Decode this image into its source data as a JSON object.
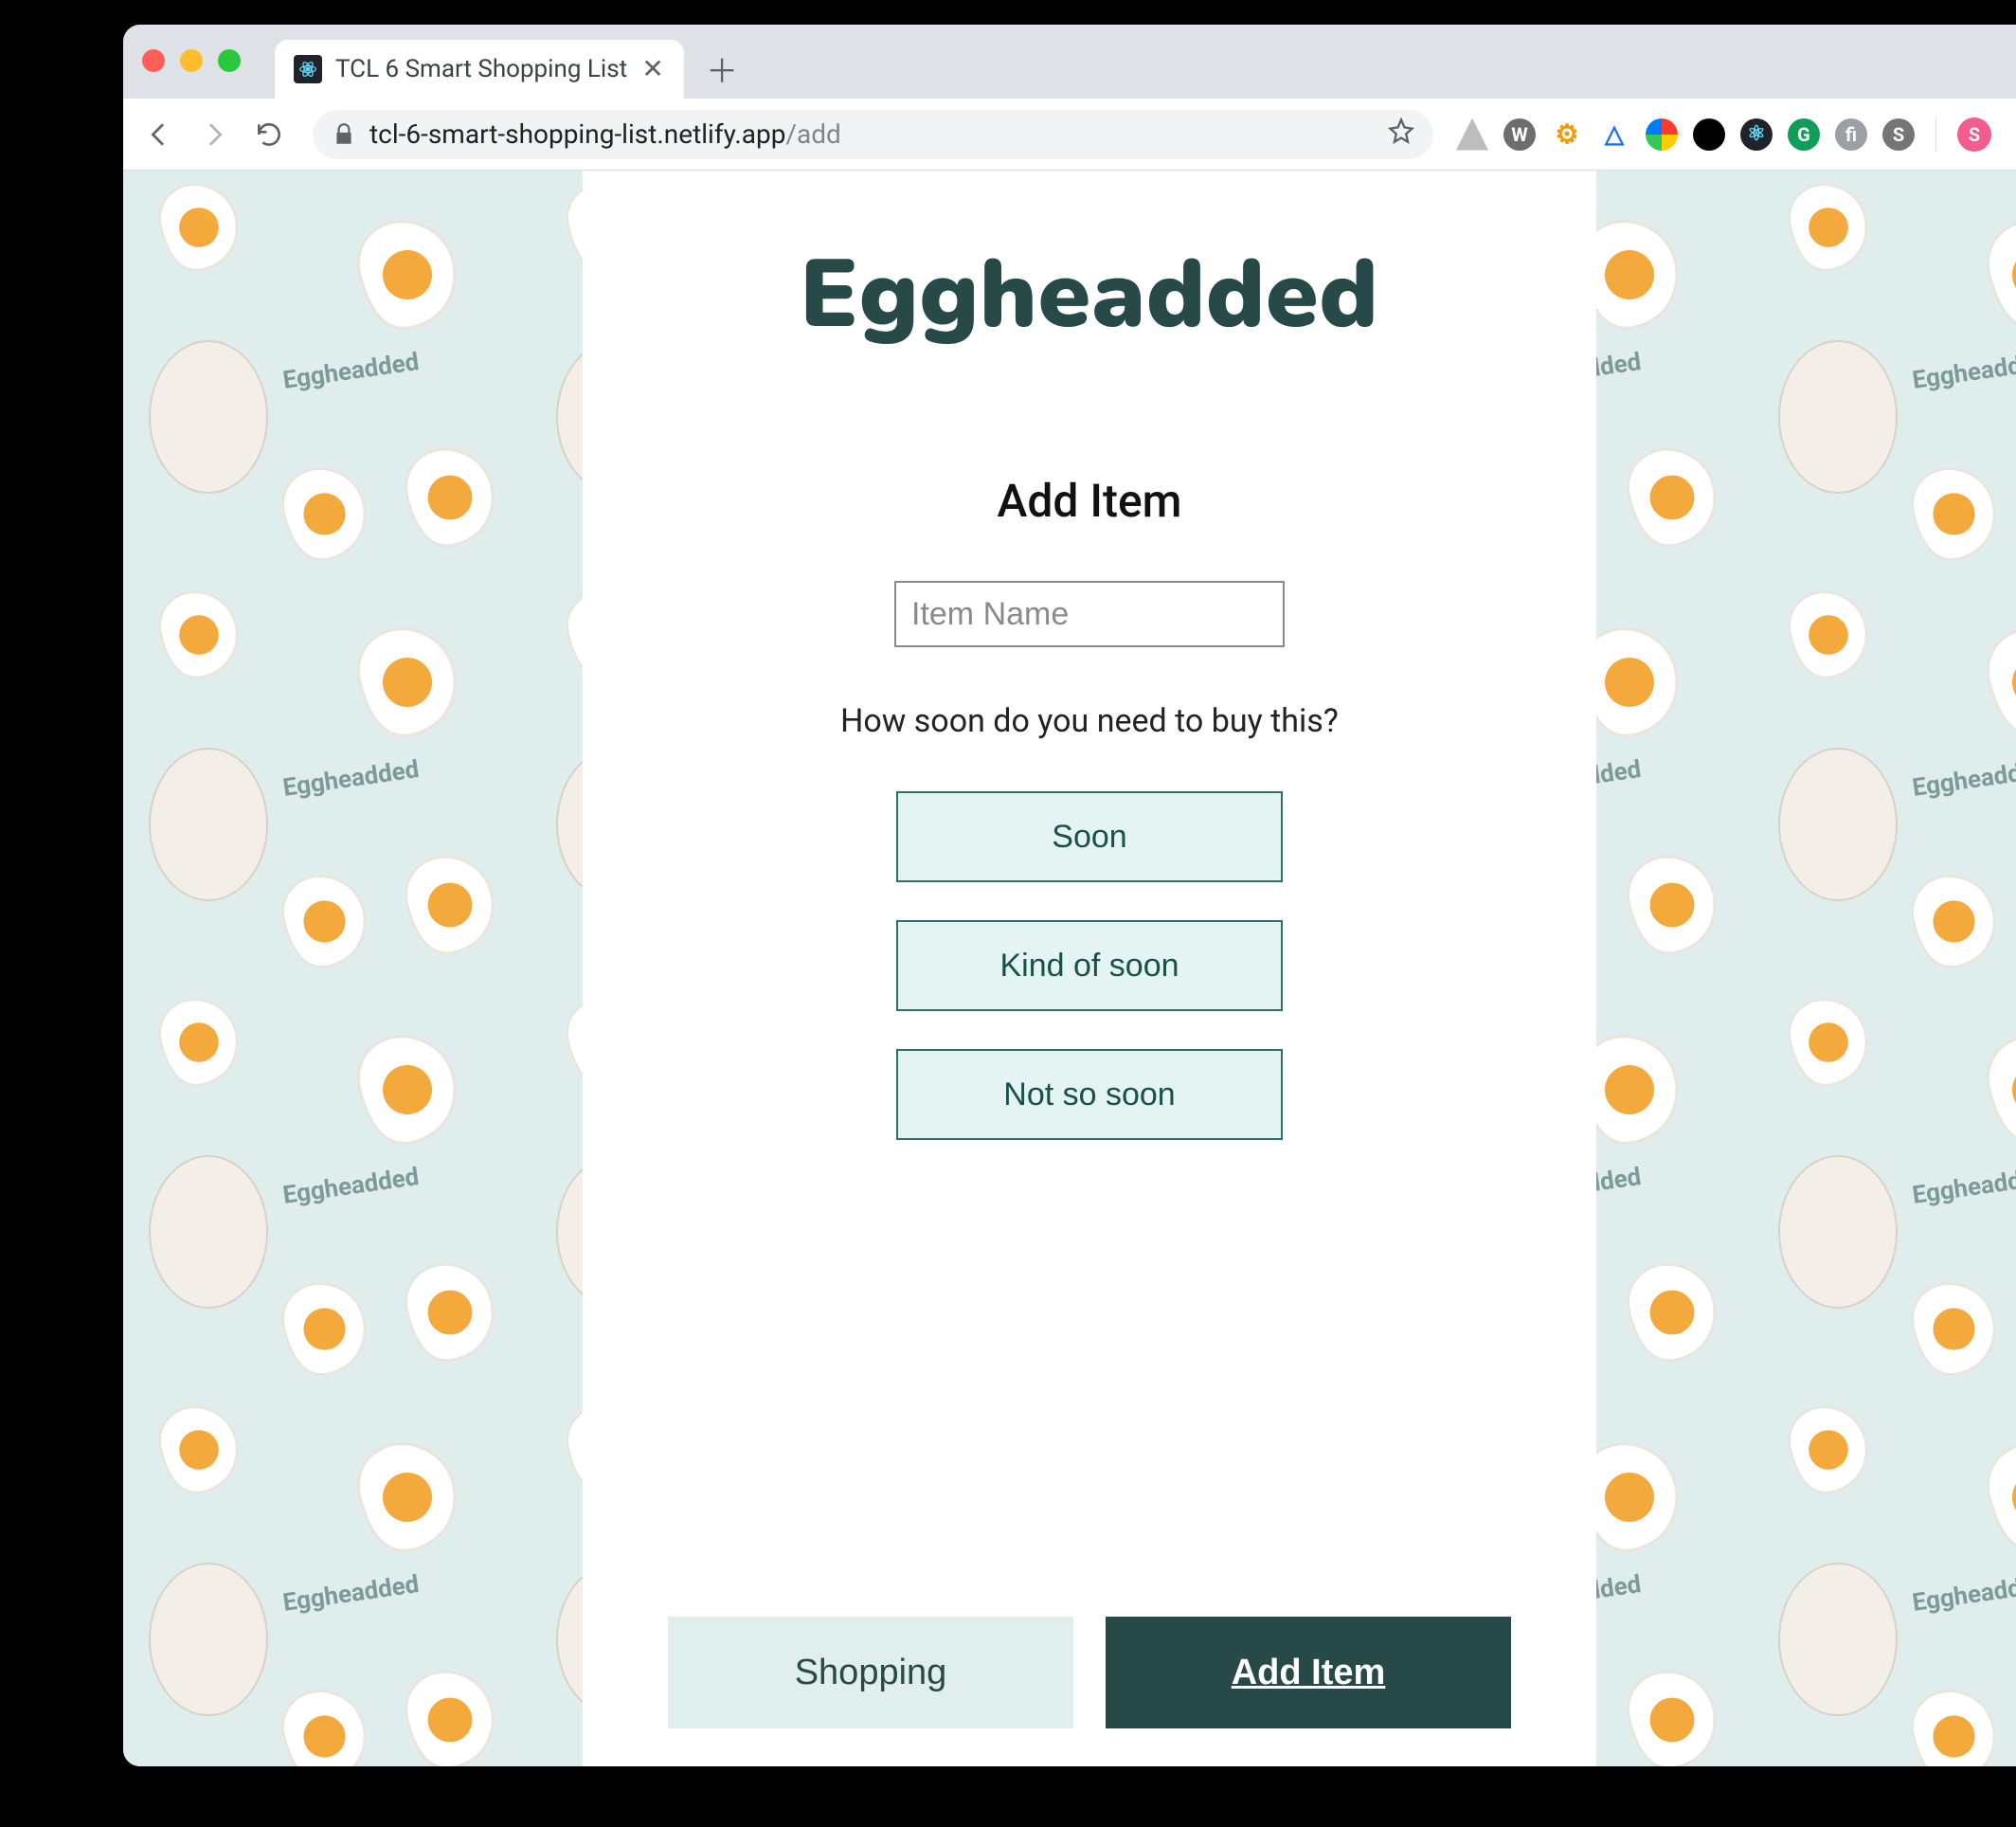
{
  "browser": {
    "tab_title": "TCL 6 Smart Shopping List",
    "url_host": "tcl-6-smart-shopping-list.netlify.app",
    "url_path": "/add",
    "avatar_initial": "S"
  },
  "app": {
    "brand": "Eggheadded",
    "section_title": "Add Item",
    "item_input_placeholder": "Item Name",
    "prompt": "How soon do you need to buy this?",
    "frequency_options": [
      "Soon",
      "Kind of soon",
      "Not so soon"
    ],
    "nav": {
      "shopping": "Shopping",
      "add_item": "Add Item"
    }
  },
  "colors": {
    "brand_dark": "#274948",
    "pale_teal": "#e4f4f2",
    "bg_teal": "#dfeeec"
  }
}
